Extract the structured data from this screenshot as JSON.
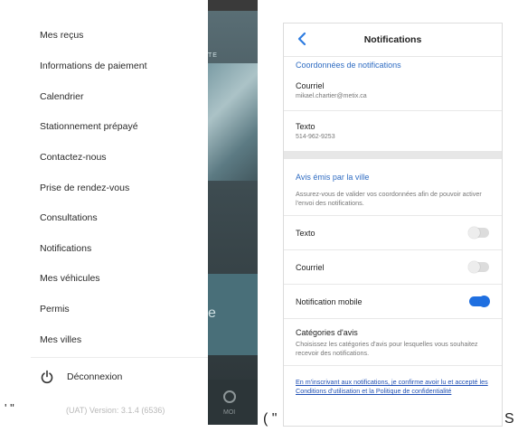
{
  "menu": {
    "items": [
      {
        "label": "Mes reçus"
      },
      {
        "label": "Informations de paiement"
      },
      {
        "label": "Calendrier"
      },
      {
        "label": "Stationnement prépayé"
      },
      {
        "label": "Contactez-nous"
      },
      {
        "label": "Prise de rendez-vous"
      },
      {
        "label": "Consultations"
      },
      {
        "label": "Notifications"
      },
      {
        "label": "Mes véhicules"
      },
      {
        "label": "Permis"
      },
      {
        "label": "Mes villes"
      }
    ],
    "logout_label": "Déconnexion",
    "logout_icon": "power-icon",
    "version": "(UAT) Version: 3.1.4 (6536)"
  },
  "background_app": {
    "tab_moi": "MOI",
    "partial_e": "e",
    "partial_te": "TE"
  },
  "notifications": {
    "title": "Notifications",
    "back_icon": "chevron-left-icon",
    "coords_heading": "Coordonnées de notifications",
    "email_label": "Courriel",
    "email_value": "mikael.chartier@metix.ca",
    "sms_label": "Texto",
    "sms_value": "514-962-9253",
    "city_heading": "Avis émis par la ville",
    "city_description": "Assurez-vous de valider vos coordonnées afin de pouvoir activer l'envoi des notifications.",
    "toggles": [
      {
        "label": "Texto",
        "on": false
      },
      {
        "label": "Courriel",
        "on": false
      },
      {
        "label": "Notification mobile",
        "on": true
      }
    ],
    "categories_title": "Catégories d'avis",
    "categories_description": "Choisissez les catégories d'avis pour lesquelles vous souhaitez recevoir des notifications.",
    "terms": "En m'inscrivant aux notifications, je confirme avoir lu et accepté les Conditions d'utilisation et la Politique de confidentialité",
    "accent_color": "#2f6cc2",
    "toggle_on_color": "#1f6fe0"
  },
  "fragments": {
    "left_quote": "' \"",
    "mid_paren": "( \"",
    "right_s": "S"
  }
}
